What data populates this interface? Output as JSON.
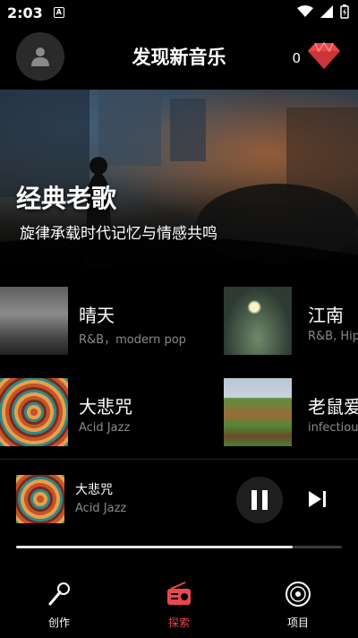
{
  "status": {
    "time": "2:03",
    "app_icon_letter": "A"
  },
  "header": {
    "title": "发现新音乐",
    "gem_count": "0"
  },
  "banner": {
    "title": "经典老歌",
    "subtitle": "旋律承载时代记忆与情感共鸣"
  },
  "songs": [
    {
      "title": "晴天",
      "subtitle": "R&B，modern pop",
      "art": "cloudy-tree-art"
    },
    {
      "title": "江南",
      "subtitle": "R&B, Hip hop",
      "art": "moonlit-lake-art"
    },
    {
      "title": "大悲咒",
      "subtitle": "Acid Jazz",
      "art": "mandala-art"
    },
    {
      "title": "老鼠爱大米",
      "subtitle": "infectious pop",
      "art": "farm-field-art"
    }
  ],
  "player": {
    "title": "大悲咒",
    "subtitle": "Acid Jazz",
    "progress": 0.85
  },
  "nav": {
    "items": [
      {
        "label": "创作"
      },
      {
        "label": "探索"
      },
      {
        "label": "项目"
      }
    ],
    "active_index": 1
  },
  "colors": {
    "accent": "#e8474c",
    "background": "#000000",
    "secondary_text": "#8a8a8a"
  }
}
